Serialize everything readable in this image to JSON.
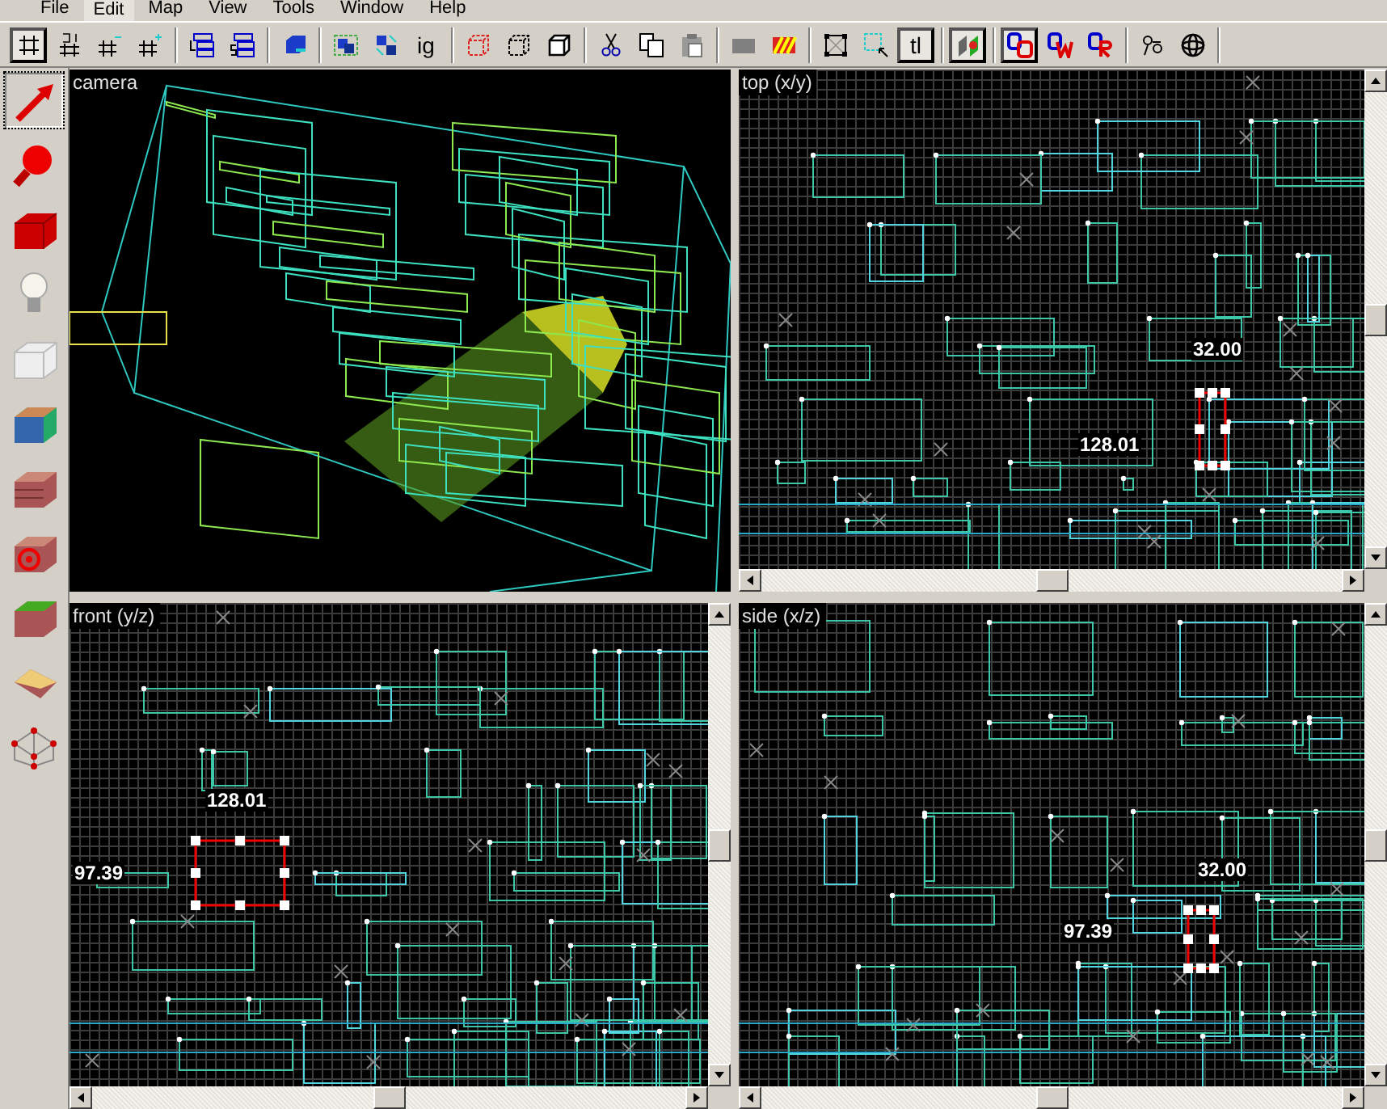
{
  "menu": [
    {
      "label": "File",
      "selected": false
    },
    {
      "label": "Edit",
      "selected": true
    },
    {
      "label": "Map",
      "selected": false
    },
    {
      "label": "View",
      "selected": false
    },
    {
      "label": "Tools",
      "selected": false
    },
    {
      "label": "Window",
      "selected": false
    },
    {
      "label": "Help",
      "selected": false
    }
  ],
  "toolbar": [
    [
      {
        "kind": "icon",
        "pressed": true
      },
      {
        "kind": "icon",
        "pressed": false
      },
      {
        "kind": "icon",
        "pressed": false
      },
      {
        "kind": "icon",
        "pressed": false
      }
    ],
    [
      {
        "kind": "icon",
        "pressed": false
      },
      {
        "kind": "icon",
        "pressed": false
      }
    ],
    [
      {
        "kind": "icon",
        "pressed": false
      }
    ],
    [
      {
        "kind": "icon",
        "pressed": false
      },
      {
        "kind": "icon",
        "pressed": false
      },
      {
        "kind": "text",
        "label": "ig",
        "pressed": false
      }
    ],
    [
      {
        "kind": "icon",
        "pressed": false
      },
      {
        "kind": "icon",
        "pressed": false
      },
      {
        "kind": "icon",
        "pressed": false
      }
    ],
    [
      {
        "kind": "icon",
        "pressed": false
      },
      {
        "kind": "icon",
        "pressed": false
      },
      {
        "kind": "icon",
        "pressed": false
      }
    ],
    [
      {
        "kind": "icon",
        "pressed": false
      },
      {
        "kind": "icon",
        "pressed": false
      }
    ],
    [
      {
        "kind": "icon",
        "pressed": false
      },
      {
        "kind": "icon",
        "pressed": false
      },
      {
        "kind": "text",
        "label": "tl",
        "pressed": true
      }
    ],
    [
      {
        "kind": "icon",
        "pressed": true
      }
    ],
    [
      {
        "kind": "icon",
        "pressed": true
      },
      {
        "kind": "icon",
        "pressed": false
      },
      {
        "kind": "icon",
        "pressed": false
      }
    ],
    [
      {
        "kind": "icon",
        "pressed": false
      },
      {
        "kind": "icon",
        "pressed": false
      }
    ]
  ],
  "tools": [
    {
      "selected": true
    },
    {
      "selected": false
    },
    {
      "selected": false
    },
    {
      "selected": false
    },
    {
      "selected": false
    },
    {
      "selected": false
    },
    {
      "selected": false
    },
    {
      "selected": false
    },
    {
      "selected": false
    },
    {
      "selected": false
    },
    {
      "selected": false
    }
  ],
  "viewports": [
    {
      "kind": "camera",
      "label": "camera"
    },
    {
      "kind": "top",
      "label": "top (x/y)",
      "width_label": "32.00",
      "height_label": "128.01"
    },
    {
      "kind": "front",
      "label": "front (y/z)",
      "width_label": "128.01",
      "height_label": "97.39"
    },
    {
      "kind": "side",
      "label": "side (x/z)",
      "width_label": "32.00",
      "height_label": "97.39"
    }
  ]
}
